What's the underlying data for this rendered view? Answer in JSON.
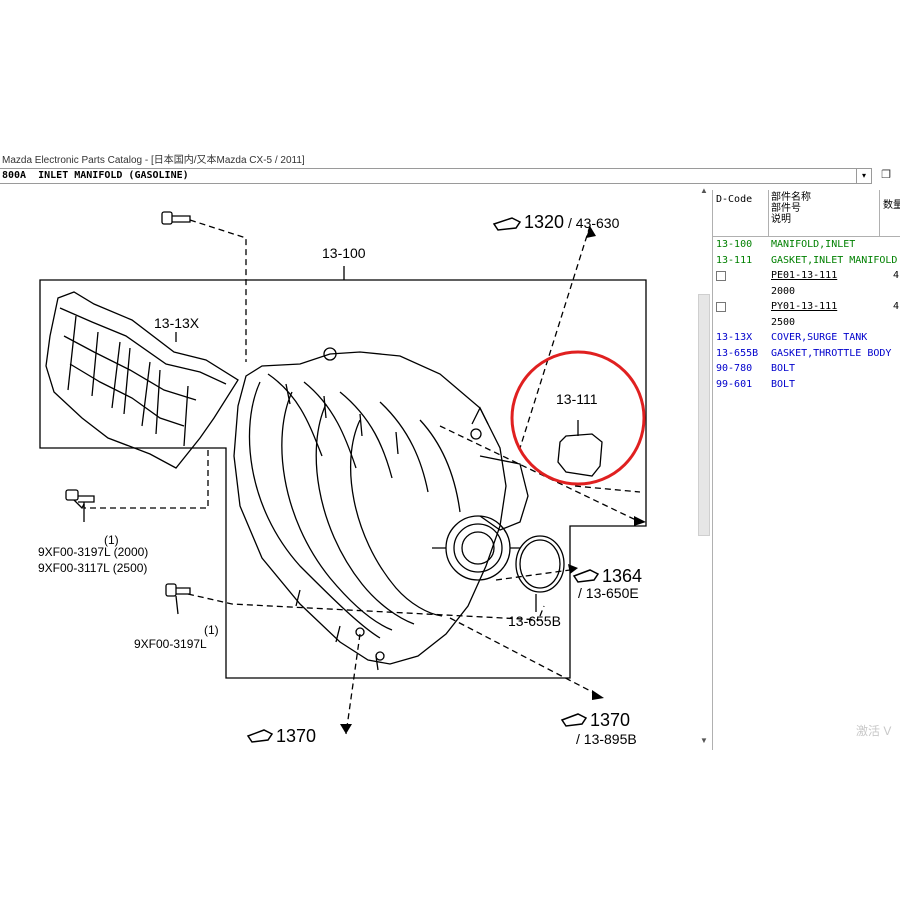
{
  "window": {
    "title": "Mazda Electronic Parts Catalog - [日本国内/又本Mazda CX-5 / 2011]",
    "minimize_icon": "▾",
    "restore_icon": "❐"
  },
  "selector": {
    "value": "800A  INLET MANIFOLD (GASOLINE)",
    "arrow": "▾"
  },
  "diagram": {
    "labels": {
      "manifold": "13-100",
      "surge_cover": "13-13X",
      "gasket_circled": "13-111",
      "throttle_gasket": "13-655B",
      "ref_1320": "1320",
      "ref_1320_sub": "/ 43-630",
      "ref_1364": "1364",
      "ref_1364_sub": "/ 13-650E",
      "ref_1370_right": "1370",
      "ref_1370_right_sub": "/ 13-895B",
      "ref_1370_left": "1370",
      "bolt_a_qty": "(1)",
      "bolt_a_line1": "9XF00-3197L (2000)",
      "bolt_a_line2": "9XF00-3117L (2500)",
      "bolt_b_qty": "(1)",
      "bolt_b": "9XF00-3197L"
    },
    "highlight_color": "#e02020"
  },
  "parts_table": {
    "headers": {
      "dcode": "D-Code",
      "name_line1": "部件名称",
      "name_line2": "部件号",
      "name_line3": "说明",
      "qty": "数量"
    },
    "rows": [
      {
        "code": "13-100",
        "desc": "MANIFOLD,INLET",
        "color": "green"
      },
      {
        "code": "13-111",
        "desc": "GASKET,INLET MANIFOLD",
        "color": "green"
      },
      {
        "code": "",
        "desc": "PE01-13-111",
        "qty": "4",
        "checkbox": true,
        "color": "black",
        "underline": true
      },
      {
        "code": "",
        "desc": "2000",
        "color": "black"
      },
      {
        "code": "",
        "desc": "PY01-13-111",
        "qty": "4",
        "checkbox": true,
        "color": "black",
        "underline": true
      },
      {
        "code": "",
        "desc": "2500",
        "color": "black"
      },
      {
        "code": "13-13X",
        "desc": "COVER,SURGE TANK",
        "color": "blue"
      },
      {
        "code": "13-655B",
        "desc": "GASKET,THROTTLE BODY",
        "color": "blue"
      },
      {
        "code": "90-780",
        "desc": "BOLT",
        "color": "blue"
      },
      {
        "code": "99-601",
        "desc": "BOLT",
        "color": "blue"
      }
    ]
  },
  "watermark": "激活 V"
}
